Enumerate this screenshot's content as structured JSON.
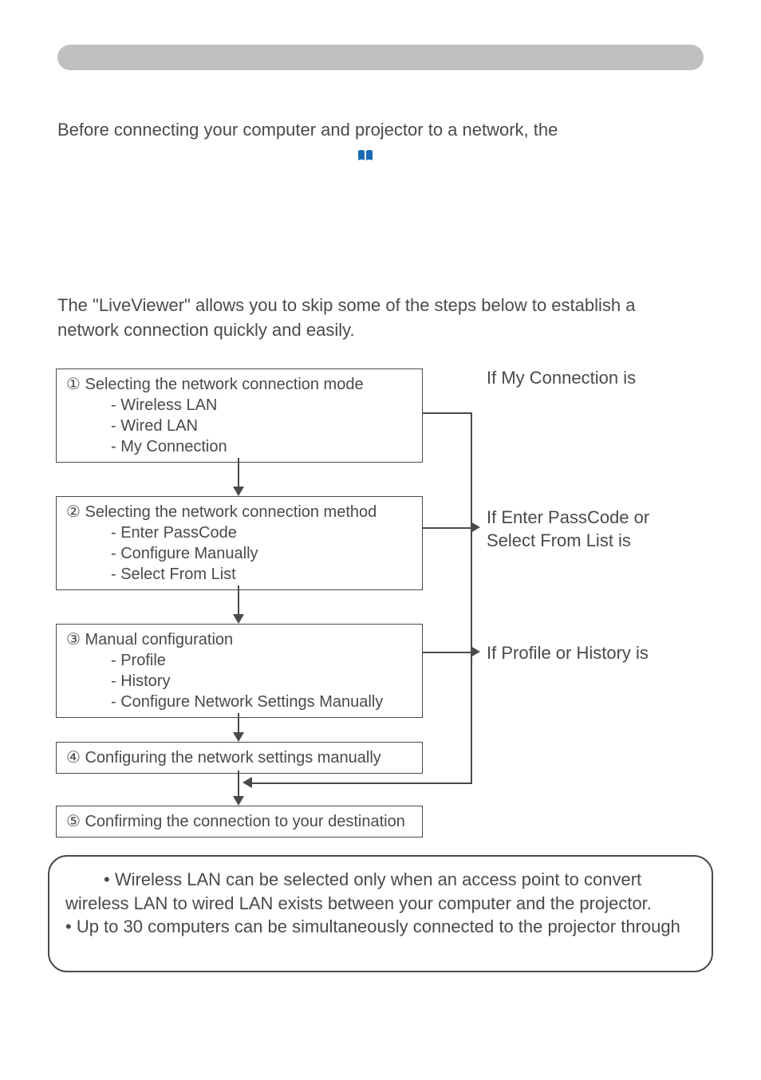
{
  "intro": {
    "line1": "Before connecting your computer and projector to a network, the"
  },
  "section": {
    "line1": "The \"LiveViewer\" allows you to skip some of the steps below to establish a",
    "line2": "network connection quickly and easily."
  },
  "flowchart": {
    "box1": {
      "title": "① Selecting the network connection mode",
      "item1": "- Wireless LAN",
      "item2": "- Wired LAN",
      "item3": "- My Connection"
    },
    "box2": {
      "title": "② Selecting the network connection method",
      "item1": "- Enter PassCode",
      "item2": "- Configure Manually",
      "item3": "- Select From List"
    },
    "box3": {
      "title": "③ Manual configuration",
      "item1": "- Profile",
      "item2": "- History",
      "item3": "- Configure Network Settings Manually"
    },
    "box4": {
      "title": "④ Configuring the network settings manually"
    },
    "box5": {
      "title": "⑤ Confirming the connection to your destination"
    },
    "label1": "If My Connection is",
    "label2_line1": "If Enter PassCode or",
    "label2_line2": "Select From List is",
    "label3": "If Profile or History is"
  },
  "note": {
    "line1": "• Wireless LAN can be selected only when an access point to convert",
    "line2": "wireless LAN to wired LAN exists between your computer and the projector.",
    "line3": "• Up to 30 computers can be simultaneously connected to the projector through"
  }
}
